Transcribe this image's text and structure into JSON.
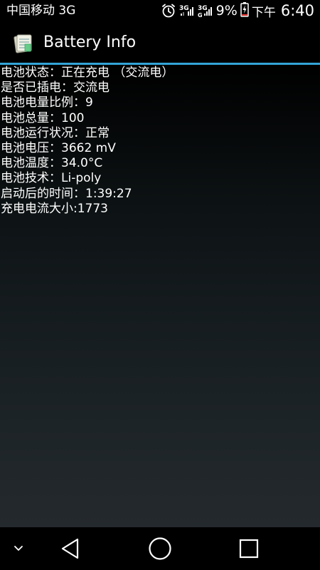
{
  "status_bar": {
    "carrier": "中国移动 3G",
    "battery_percent": "9%",
    "time_period": "下午",
    "time": "6:40",
    "icons": [
      "alarm-icon",
      "signal-3g-icon",
      "signal-3g-icon",
      "battery-charging-icon"
    ]
  },
  "action_bar": {
    "title": "Battery Info",
    "icon": "app-icon",
    "accent_color": "#33a4d6"
  },
  "info_lines": [
    "电池状态：正在充电 （交流电）",
    "是否已插电：交流电",
    "电池电量比例：9",
    "电池总量：100",
    "电池运行状况：正常",
    "电池电压：3662 mV",
    "电池温度：34.0°C",
    "电池技术：Li-poly",
    "启动后的时间：1:39:27",
    "充电电流大小:1773"
  ],
  "nav_bar": {
    "buttons": [
      "chevron-down-icon",
      "back-icon",
      "home-icon",
      "recents-icon"
    ]
  }
}
